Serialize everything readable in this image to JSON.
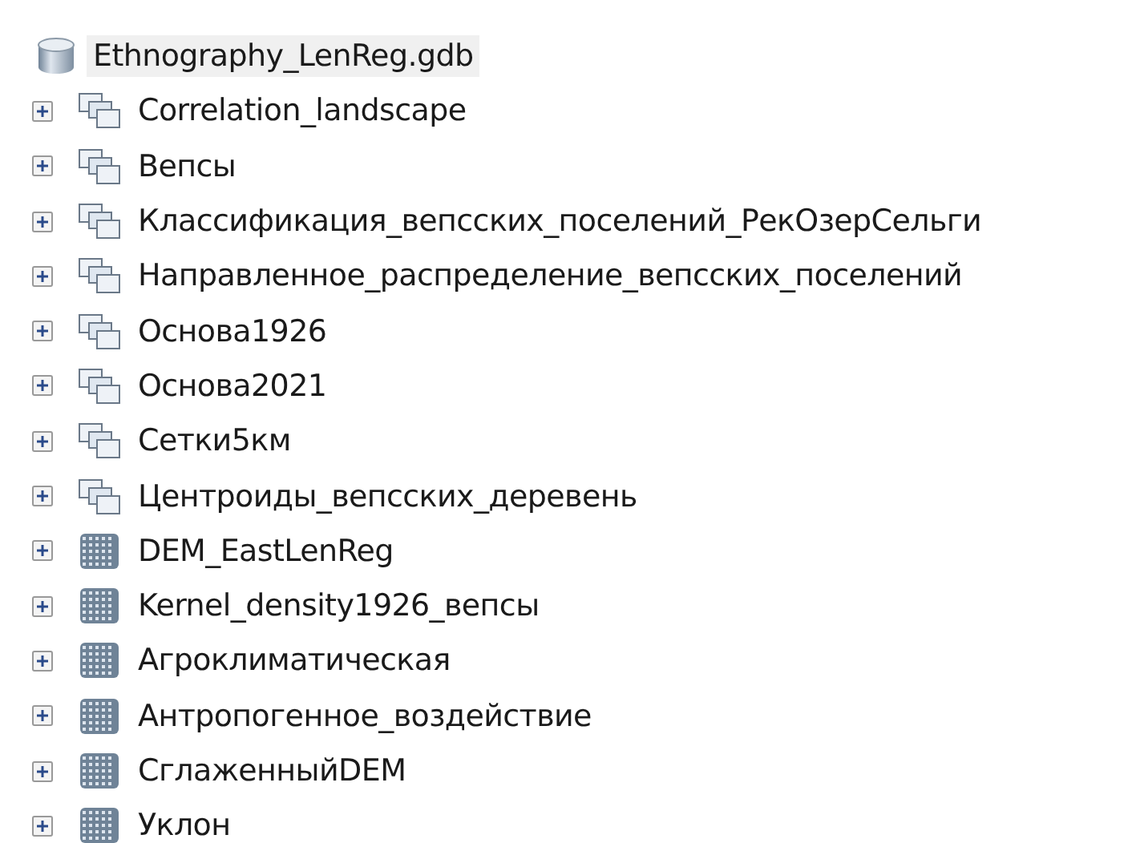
{
  "tree": {
    "label": "Ethnography_LenReg.gdb",
    "kind": "geodatabase",
    "selected": true,
    "expanded": true,
    "children": [
      {
        "label": "Correlation_landscape",
        "kind": "feature_dataset",
        "expanded": false,
        "selected": false
      },
      {
        "label": "Вепсы",
        "kind": "feature_dataset",
        "expanded": false,
        "selected": false
      },
      {
        "label": "Классификация_вепсских_поселений_РекОзерСельги",
        "kind": "feature_dataset",
        "expanded": false,
        "selected": false
      },
      {
        "label": "Направленное_распределение_вепсских_поселений",
        "kind": "feature_dataset",
        "expanded": false,
        "selected": false
      },
      {
        "label": "Основа1926",
        "kind": "feature_dataset",
        "expanded": false,
        "selected": false
      },
      {
        "label": "Основа2021",
        "kind": "feature_dataset",
        "expanded": false,
        "selected": false
      },
      {
        "label": "Сетки5км",
        "kind": "feature_dataset",
        "expanded": false,
        "selected": false
      },
      {
        "label": "Центроиды_вепсских_деревень",
        "kind": "feature_dataset",
        "expanded": false,
        "selected": false
      },
      {
        "label": "DEM_EastLenReg",
        "kind": "raster",
        "expanded": false,
        "selected": false
      },
      {
        "label": "Kernel_density1926_вепсы",
        "kind": "raster",
        "expanded": false,
        "selected": false
      },
      {
        "label": "Агроклиматическая",
        "kind": "raster",
        "expanded": false,
        "selected": false
      },
      {
        "label": "Антропогенное_воздействие",
        "kind": "raster",
        "expanded": false,
        "selected": false
      },
      {
        "label": "СглаженныйDEM",
        "kind": "raster",
        "expanded": false,
        "selected": false
      },
      {
        "label": "Уклон",
        "kind": "raster",
        "expanded": false,
        "selected": false
      }
    ]
  }
}
